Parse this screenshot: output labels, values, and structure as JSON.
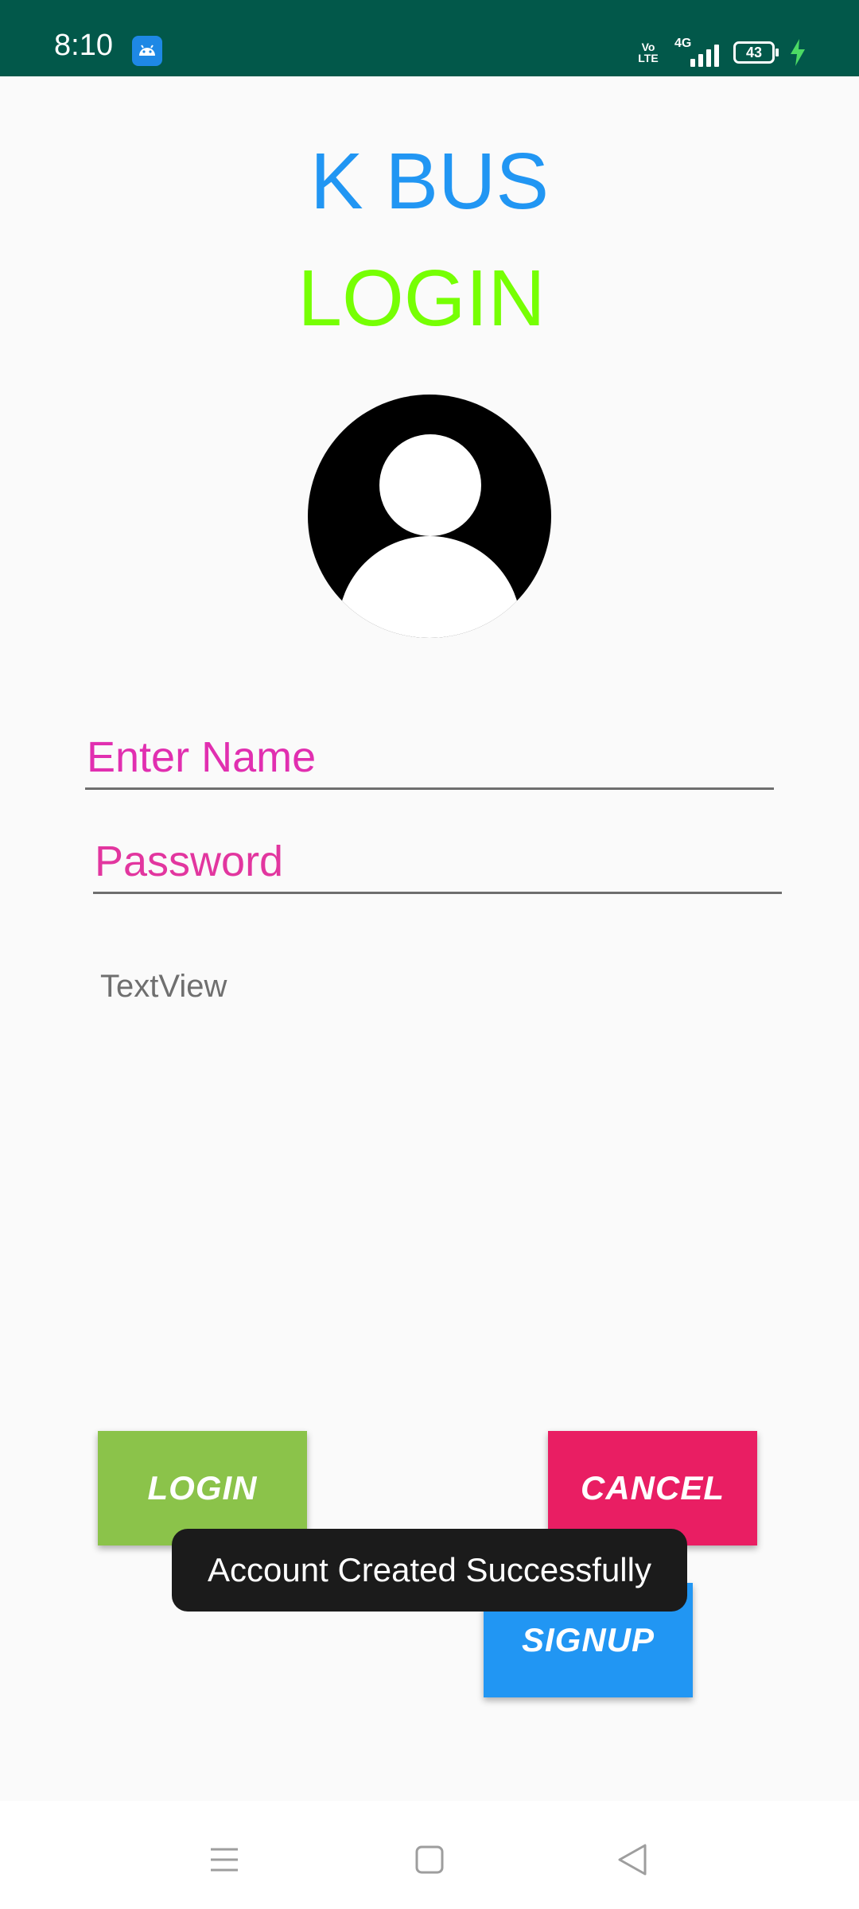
{
  "status_bar": {
    "time": "8:10",
    "volte": "Vo LTE",
    "network": "4G",
    "battery": "43",
    "app_icon": "android-icon"
  },
  "header": {
    "app_title": "K BUS",
    "screen_title": "LOGIN"
  },
  "form": {
    "name_placeholder": "Enter Name",
    "password_placeholder": "Password",
    "textview": "TextView"
  },
  "buttons": {
    "login": "LOGIN",
    "cancel": "CANCEL",
    "signup": "SIGNUP"
  },
  "toast": {
    "message": "Account Created Successfully"
  },
  "nav_bar": {
    "icons": [
      "menu-icon",
      "home-icon",
      "back-icon"
    ]
  },
  "colors": {
    "status_bar": "#02584a",
    "app_title": "#2196f3",
    "screen_title": "#76ff03",
    "hint": "#e12fb0",
    "login_button": "#8bc34a",
    "cancel_button": "#e91e63",
    "signup_button": "#2196f3"
  }
}
